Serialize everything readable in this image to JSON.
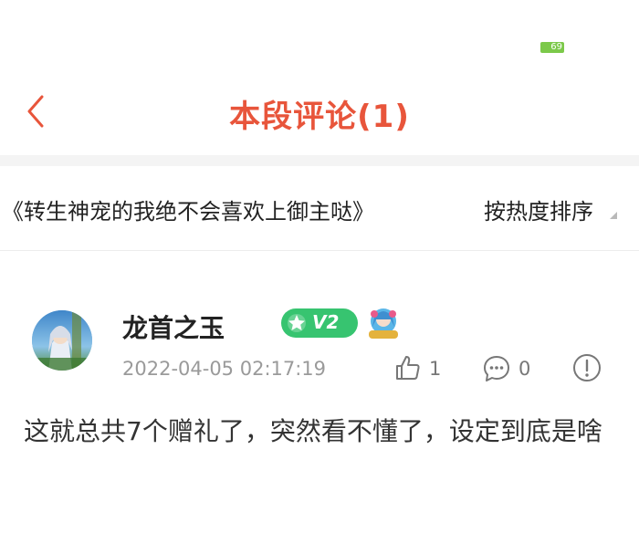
{
  "status_bar": {
    "battery_level": "69",
    "battery_color": "#7cc94a"
  },
  "header": {
    "back_icon": "chevron-left-icon",
    "title": "本段评论(1)",
    "accent_color": "#e8553b"
  },
  "sub_bar": {
    "book_title": "《转生神宠的我绝不会喜欢上御主哒》",
    "sort_label": "按热度排序"
  },
  "comment": {
    "username": "龙首之玉",
    "vip_badge": {
      "icon": "star-icon",
      "level": "V2",
      "color": "#37c470"
    },
    "medal_icon": "anime-medal-icon",
    "timestamp": "2022-04-05 02:17:19",
    "likes": "1",
    "replies": "0",
    "icons": {
      "like": "thumbs-up-icon",
      "reply": "speech-bubble-icon",
      "report": "exclamation-circle-icon"
    },
    "text": "这就总共7个赠礼了，突然看不懂了，设定到底是啥"
  }
}
